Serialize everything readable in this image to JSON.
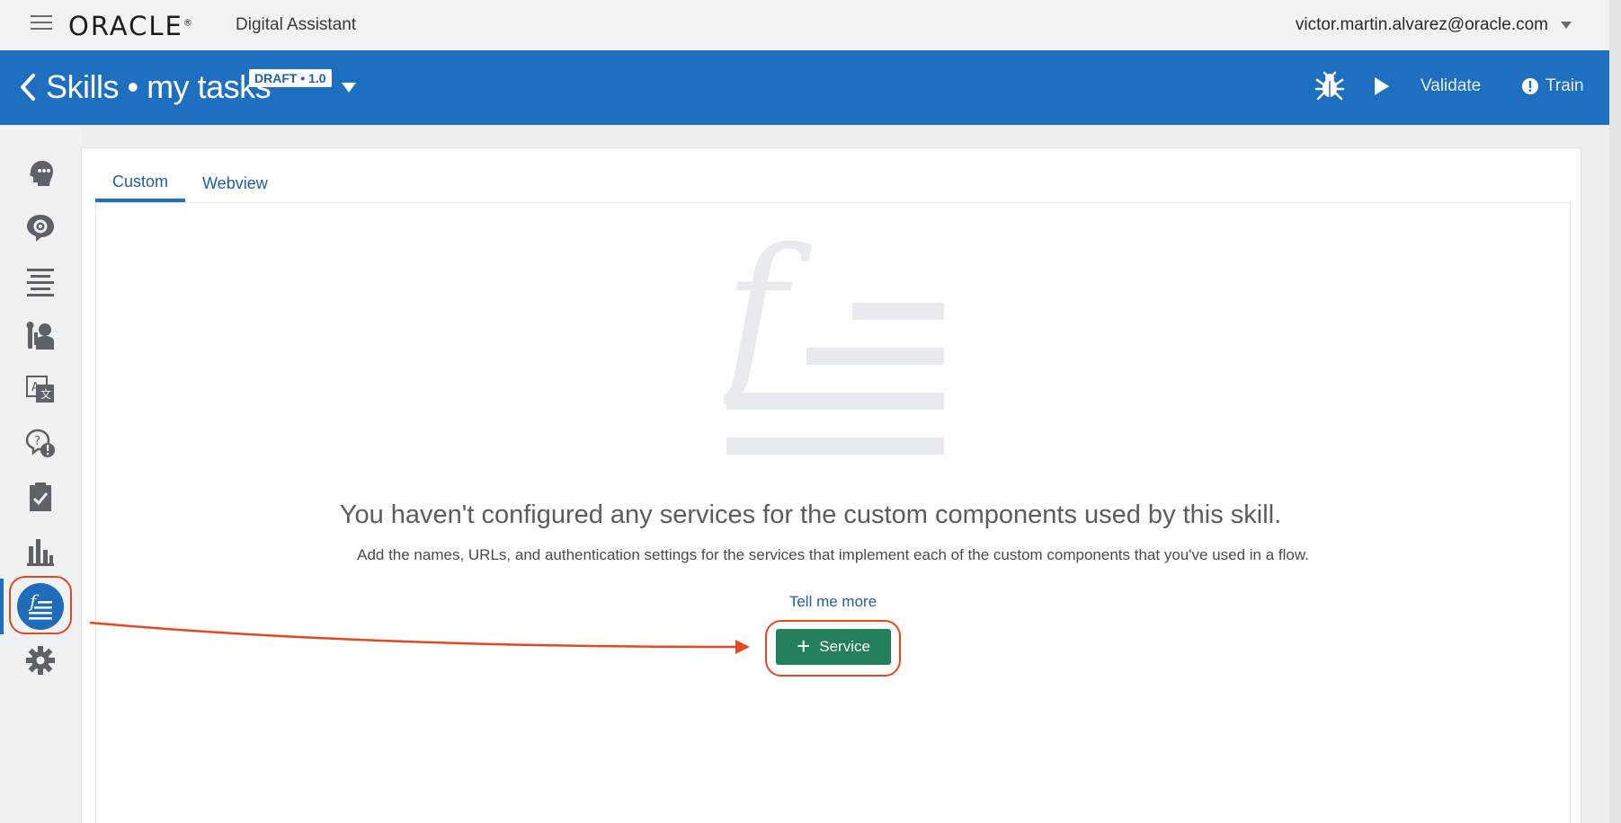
{
  "topbar": {
    "brand": "ORACLE",
    "brand_mark": "®",
    "product": "Digital Assistant",
    "user_email": "victor.martin.alvarez@oracle.com"
  },
  "header": {
    "title": "Skills • my tasks",
    "badge": "DRAFT • 1.0",
    "validate_label": "Validate",
    "train_label": "Train"
  },
  "sidebar": {
    "items": [
      {
        "icon": "intents-icon"
      },
      {
        "icon": "entities-icon"
      },
      {
        "icon": "flows-icon"
      },
      {
        "icon": "components-icon"
      },
      {
        "icon": "resource-bundles-icon"
      },
      {
        "icon": "qna-icon"
      },
      {
        "icon": "quality-icon"
      },
      {
        "icon": "insights-icon"
      },
      {
        "icon": "custom-components-icon",
        "active": true
      },
      {
        "icon": "settings-icon"
      }
    ],
    "accent": "#1e6fbf"
  },
  "tabs": [
    {
      "label": "Custom",
      "active": true
    },
    {
      "label": "Webview",
      "active": false
    }
  ],
  "empty_state": {
    "title": "You haven't configured any services for the custom components used by this skill.",
    "description": "Add the names, URLs, and authentication settings for the services that implement each of the custom components that you've used in a flow.",
    "link": "Tell me more",
    "button_label": "Service"
  },
  "colors": {
    "header_blue": "#1e6fbf",
    "button_green": "#23805b",
    "annotation_red": "#e5471f"
  }
}
